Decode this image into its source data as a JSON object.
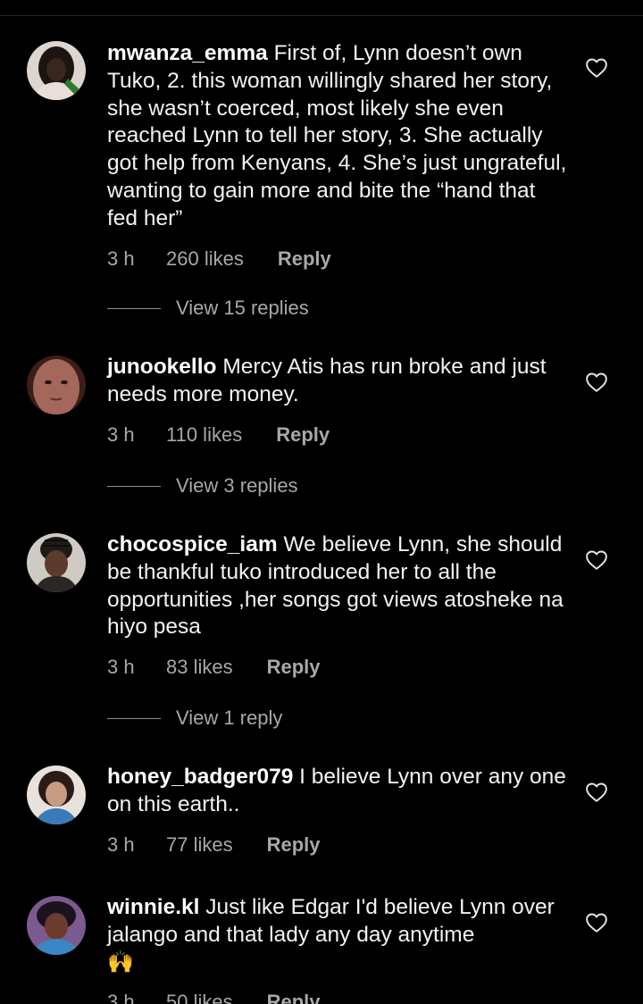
{
  "comments": [
    {
      "username": "mwanza_emma",
      "text": "First of, Lynn doesn’t own Tuko, 2. this woman willingly shared her story, she wasn’t coerced, most likely she even reached Lynn to tell her story, 3. She actually got help from Kenyans, 4. She’s just ungrateful, wanting to gain more and bite the “hand that fed her”",
      "time": "3 h",
      "likes": "260 likes",
      "reply_label": "Reply",
      "view_replies": "View 15 replies"
    },
    {
      "username": "junookello",
      "text": "Mercy Atis has run broke and just needs more money.",
      "time": "3 h",
      "likes": "110 likes",
      "reply_label": "Reply",
      "view_replies": "View 3 replies"
    },
    {
      "username": "chocospice_iam",
      "text": "We believe Lynn, she should be thankful tuko introduced her to all the opportunities ,her songs got views atosheke na hiyo pesa",
      "time": "3 h",
      "likes": "83 likes",
      "reply_label": "Reply",
      "view_replies": "View 1 reply"
    },
    {
      "username": "honey_badger079",
      "text": "I believe Lynn over any one on this earth..",
      "time": "3 h",
      "likes": "77 likes",
      "reply_label": "Reply"
    },
    {
      "username": "winnie.kl",
      "text": "Just like Edgar I'd believe Lynn over jalango and that lady any day anytime",
      "emoji": "🙌",
      "time": "3 h",
      "likes": "50 likes",
      "reply_label": "Reply"
    }
  ],
  "icons": {
    "like": "heart-outline-icon",
    "avatar": "user-avatar"
  },
  "colors": {
    "background": "#000000",
    "text_primary": "#f2f2f2",
    "text_secondary": "#a8a8a8",
    "divider": "#262626"
  }
}
